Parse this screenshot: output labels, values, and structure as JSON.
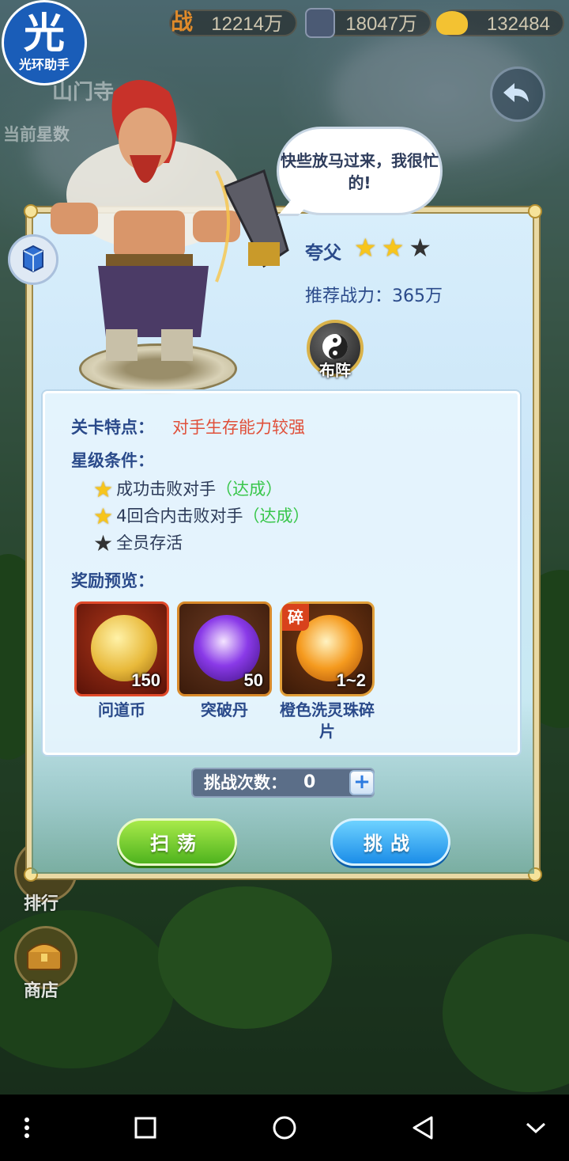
{
  "resources": {
    "power_icon_label": "战",
    "power": "12214万",
    "silver": "18047万",
    "gold": "132484"
  },
  "helper": {
    "logo_char": "光",
    "logo_text": "光环助手"
  },
  "background": {
    "stage_title": "山门寺",
    "star_count_label": "当前星数",
    "side_items": [
      "排行",
      "商店"
    ]
  },
  "boss": {
    "speech": "快些放马过来，我很忙的!",
    "name": "夸父",
    "stars_earned": 2,
    "stars_total": 3,
    "recommended_power": "推荐战力：365万",
    "formation_label": "布阵"
  },
  "stage": {
    "feature_label": "关卡特点：",
    "feature_value": "对手生存能力较强",
    "star_conditions_label": "星级条件：",
    "conditions": [
      {
        "text": "成功击败对手",
        "status": "（达成）",
        "achieved": true
      },
      {
        "text": "4回合内击败对手",
        "status": "（达成）",
        "achieved": true
      },
      {
        "text": "全员存活",
        "status": "",
        "achieved": false
      }
    ],
    "rewards_label": "奖励预览：",
    "rewards": [
      {
        "name": "问道币",
        "qty": "150",
        "icon": "dao-coin-icon",
        "color": "#e8b93a"
      },
      {
        "name": "突破丹",
        "qty": "50",
        "icon": "breakthrough-pill-icon",
        "color": "#8a3ae8"
      },
      {
        "name": "橙色洗灵珠碎片",
        "qty": "1~2",
        "icon": "orange-spirit-pearl-icon",
        "color": "#f59a1e",
        "fragment_badge": "碎"
      }
    ]
  },
  "challenge": {
    "count_label": "挑战次数：",
    "count": "0",
    "plus": "+",
    "sweep_label": "扫荡",
    "challenge_label": "挑战"
  },
  "colors": {
    "accent_green": "#38c64a",
    "feature_red": "#e0503a",
    "label_blue": "#2a4a8a",
    "star_gold": "#f7c51c"
  }
}
